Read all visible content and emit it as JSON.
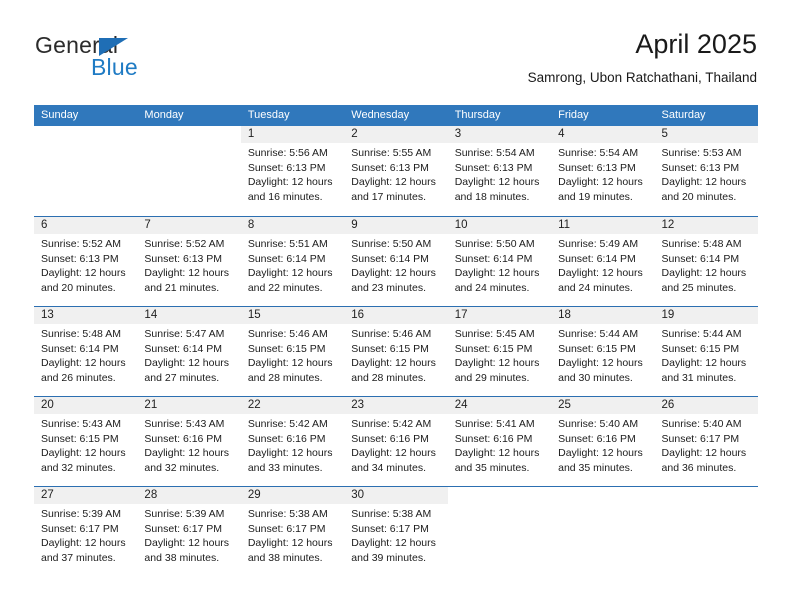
{
  "brand": {
    "word1": "General",
    "word2": "Blue",
    "triangle_color": "#1f6eb5",
    "word2_color": "#1f7bc4"
  },
  "header": {
    "title": "April 2025",
    "subtitle": "Samrong, Ubon Ratchathani, Thailand"
  },
  "theme": {
    "header_blue": "#3078bc",
    "row_divider_blue": "#2c6fb1",
    "daynum_band": "#f0f0f0"
  },
  "weekdays": [
    "Sunday",
    "Monday",
    "Tuesday",
    "Wednesday",
    "Thursday",
    "Friday",
    "Saturday"
  ],
  "weeks": [
    [
      {
        "day": "",
        "sunrise": "",
        "sunset": "",
        "daylight1": "",
        "daylight2": "",
        "empty": true
      },
      {
        "day": "",
        "sunrise": "",
        "sunset": "",
        "daylight1": "",
        "daylight2": "",
        "empty": true
      },
      {
        "day": "1",
        "sunrise": "Sunrise: 5:56 AM",
        "sunset": "Sunset: 6:13 PM",
        "daylight1": "Daylight: 12 hours",
        "daylight2": "and 16 minutes.",
        "empty": false
      },
      {
        "day": "2",
        "sunrise": "Sunrise: 5:55 AM",
        "sunset": "Sunset: 6:13 PM",
        "daylight1": "Daylight: 12 hours",
        "daylight2": "and 17 minutes.",
        "empty": false
      },
      {
        "day": "3",
        "sunrise": "Sunrise: 5:54 AM",
        "sunset": "Sunset: 6:13 PM",
        "daylight1": "Daylight: 12 hours",
        "daylight2": "and 18 minutes.",
        "empty": false
      },
      {
        "day": "4",
        "sunrise": "Sunrise: 5:54 AM",
        "sunset": "Sunset: 6:13 PM",
        "daylight1": "Daylight: 12 hours",
        "daylight2": "and 19 minutes.",
        "empty": false
      },
      {
        "day": "5",
        "sunrise": "Sunrise: 5:53 AM",
        "sunset": "Sunset: 6:13 PM",
        "daylight1": "Daylight: 12 hours",
        "daylight2": "and 20 minutes.",
        "empty": false
      }
    ],
    [
      {
        "day": "6",
        "sunrise": "Sunrise: 5:52 AM",
        "sunset": "Sunset: 6:13 PM",
        "daylight1": "Daylight: 12 hours",
        "daylight2": "and 20 minutes.",
        "empty": false
      },
      {
        "day": "7",
        "sunrise": "Sunrise: 5:52 AM",
        "sunset": "Sunset: 6:13 PM",
        "daylight1": "Daylight: 12 hours",
        "daylight2": "and 21 minutes.",
        "empty": false
      },
      {
        "day": "8",
        "sunrise": "Sunrise: 5:51 AM",
        "sunset": "Sunset: 6:14 PM",
        "daylight1": "Daylight: 12 hours",
        "daylight2": "and 22 minutes.",
        "empty": false
      },
      {
        "day": "9",
        "sunrise": "Sunrise: 5:50 AM",
        "sunset": "Sunset: 6:14 PM",
        "daylight1": "Daylight: 12 hours",
        "daylight2": "and 23 minutes.",
        "empty": false
      },
      {
        "day": "10",
        "sunrise": "Sunrise: 5:50 AM",
        "sunset": "Sunset: 6:14 PM",
        "daylight1": "Daylight: 12 hours",
        "daylight2": "and 24 minutes.",
        "empty": false
      },
      {
        "day": "11",
        "sunrise": "Sunrise: 5:49 AM",
        "sunset": "Sunset: 6:14 PM",
        "daylight1": "Daylight: 12 hours",
        "daylight2": "and 24 minutes.",
        "empty": false
      },
      {
        "day": "12",
        "sunrise": "Sunrise: 5:48 AM",
        "sunset": "Sunset: 6:14 PM",
        "daylight1": "Daylight: 12 hours",
        "daylight2": "and 25 minutes.",
        "empty": false
      }
    ],
    [
      {
        "day": "13",
        "sunrise": "Sunrise: 5:48 AM",
        "sunset": "Sunset: 6:14 PM",
        "daylight1": "Daylight: 12 hours",
        "daylight2": "and 26 minutes.",
        "empty": false
      },
      {
        "day": "14",
        "sunrise": "Sunrise: 5:47 AM",
        "sunset": "Sunset: 6:14 PM",
        "daylight1": "Daylight: 12 hours",
        "daylight2": "and 27 minutes.",
        "empty": false
      },
      {
        "day": "15",
        "sunrise": "Sunrise: 5:46 AM",
        "sunset": "Sunset: 6:15 PM",
        "daylight1": "Daylight: 12 hours",
        "daylight2": "and 28 minutes.",
        "empty": false
      },
      {
        "day": "16",
        "sunrise": "Sunrise: 5:46 AM",
        "sunset": "Sunset: 6:15 PM",
        "daylight1": "Daylight: 12 hours",
        "daylight2": "and 28 minutes.",
        "empty": false
      },
      {
        "day": "17",
        "sunrise": "Sunrise: 5:45 AM",
        "sunset": "Sunset: 6:15 PM",
        "daylight1": "Daylight: 12 hours",
        "daylight2": "and 29 minutes.",
        "empty": false
      },
      {
        "day": "18",
        "sunrise": "Sunrise: 5:44 AM",
        "sunset": "Sunset: 6:15 PM",
        "daylight1": "Daylight: 12 hours",
        "daylight2": "and 30 minutes.",
        "empty": false
      },
      {
        "day": "19",
        "sunrise": "Sunrise: 5:44 AM",
        "sunset": "Sunset: 6:15 PM",
        "daylight1": "Daylight: 12 hours",
        "daylight2": "and 31 minutes.",
        "empty": false
      }
    ],
    [
      {
        "day": "20",
        "sunrise": "Sunrise: 5:43 AM",
        "sunset": "Sunset: 6:15 PM",
        "daylight1": "Daylight: 12 hours",
        "daylight2": "and 32 minutes.",
        "empty": false
      },
      {
        "day": "21",
        "sunrise": "Sunrise: 5:43 AM",
        "sunset": "Sunset: 6:16 PM",
        "daylight1": "Daylight: 12 hours",
        "daylight2": "and 32 minutes.",
        "empty": false
      },
      {
        "day": "22",
        "sunrise": "Sunrise: 5:42 AM",
        "sunset": "Sunset: 6:16 PM",
        "daylight1": "Daylight: 12 hours",
        "daylight2": "and 33 minutes.",
        "empty": false
      },
      {
        "day": "23",
        "sunrise": "Sunrise: 5:42 AM",
        "sunset": "Sunset: 6:16 PM",
        "daylight1": "Daylight: 12 hours",
        "daylight2": "and 34 minutes.",
        "empty": false
      },
      {
        "day": "24",
        "sunrise": "Sunrise: 5:41 AM",
        "sunset": "Sunset: 6:16 PM",
        "daylight1": "Daylight: 12 hours",
        "daylight2": "and 35 minutes.",
        "empty": false
      },
      {
        "day": "25",
        "sunrise": "Sunrise: 5:40 AM",
        "sunset": "Sunset: 6:16 PM",
        "daylight1": "Daylight: 12 hours",
        "daylight2": "and 35 minutes.",
        "empty": false
      },
      {
        "day": "26",
        "sunrise": "Sunrise: 5:40 AM",
        "sunset": "Sunset: 6:17 PM",
        "daylight1": "Daylight: 12 hours",
        "daylight2": "and 36 minutes.",
        "empty": false
      }
    ],
    [
      {
        "day": "27",
        "sunrise": "Sunrise: 5:39 AM",
        "sunset": "Sunset: 6:17 PM",
        "daylight1": "Daylight: 12 hours",
        "daylight2": "and 37 minutes.",
        "empty": false
      },
      {
        "day": "28",
        "sunrise": "Sunrise: 5:39 AM",
        "sunset": "Sunset: 6:17 PM",
        "daylight1": "Daylight: 12 hours",
        "daylight2": "and 38 minutes.",
        "empty": false
      },
      {
        "day": "29",
        "sunrise": "Sunrise: 5:38 AM",
        "sunset": "Sunset: 6:17 PM",
        "daylight1": "Daylight: 12 hours",
        "daylight2": "and 38 minutes.",
        "empty": false
      },
      {
        "day": "30",
        "sunrise": "Sunrise: 5:38 AM",
        "sunset": "Sunset: 6:17 PM",
        "daylight1": "Daylight: 12 hours",
        "daylight2": "and 39 minutes.",
        "empty": false
      },
      {
        "day": "",
        "sunrise": "",
        "sunset": "",
        "daylight1": "",
        "daylight2": "",
        "empty": true
      },
      {
        "day": "",
        "sunrise": "",
        "sunset": "",
        "daylight1": "",
        "daylight2": "",
        "empty": true
      },
      {
        "day": "",
        "sunrise": "",
        "sunset": "",
        "daylight1": "",
        "daylight2": "",
        "empty": true
      }
    ]
  ]
}
